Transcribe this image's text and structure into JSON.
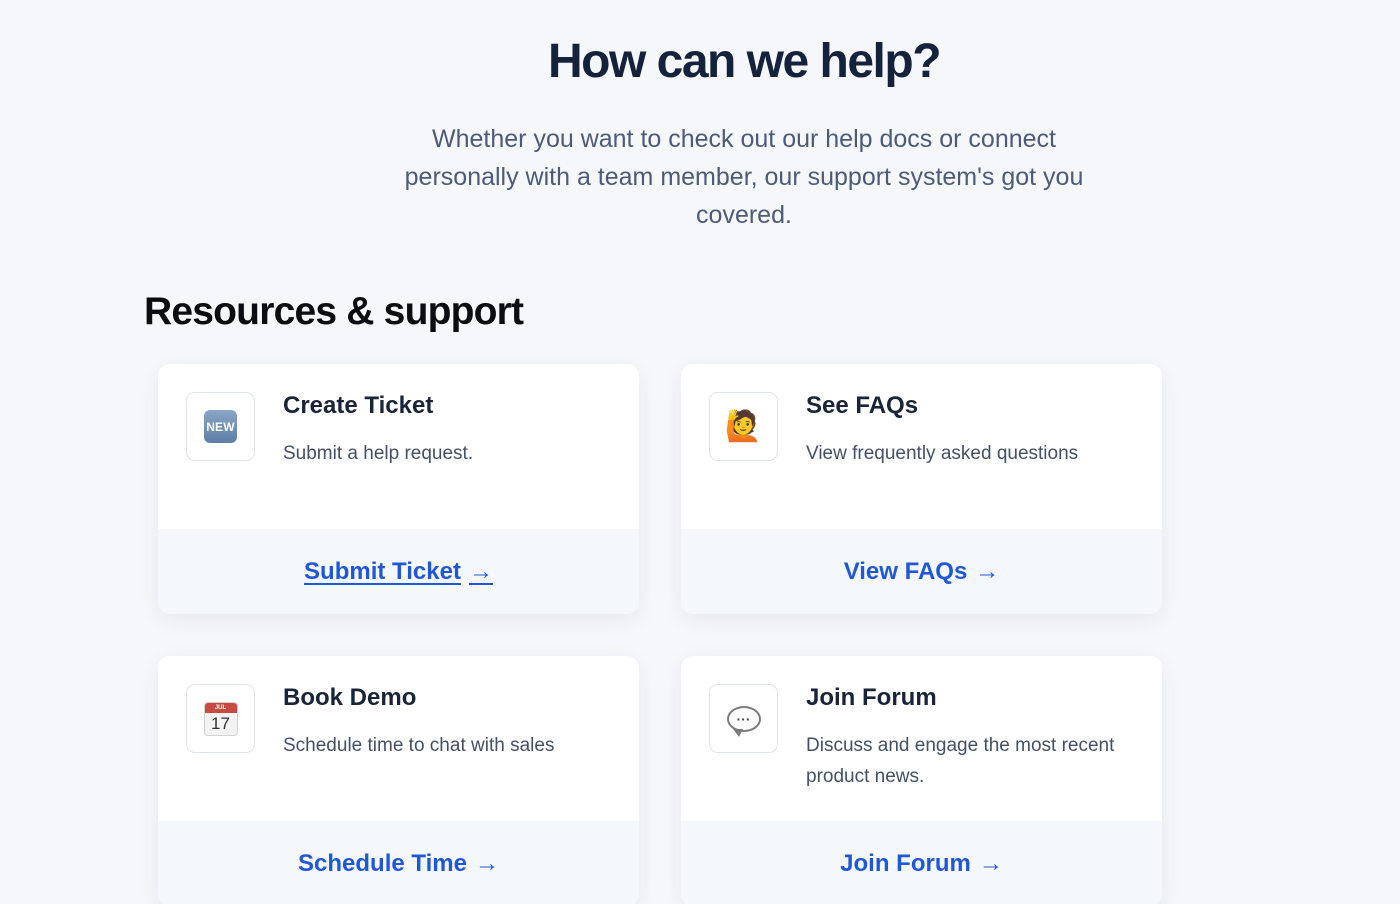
{
  "hero": {
    "title": "How can we help?",
    "subtitle": "Whether you want to check out our help docs or connect personally with a team member, our support system's got you covered."
  },
  "section": {
    "title": "Resources & support"
  },
  "cards": [
    {
      "icon": "new-badge-icon",
      "title": "Create Ticket",
      "description": "Submit a help request.",
      "link_label": "Submit Ticket",
      "arrow": "→"
    },
    {
      "icon": "person-raising-hand-icon",
      "title": "See FAQs",
      "description": "View frequently asked questions",
      "link_label": "View FAQs",
      "arrow": "→"
    },
    {
      "icon": "calendar-icon",
      "title": "Book Demo",
      "description": "Schedule time to chat with sales",
      "link_label": "Schedule Time",
      "arrow": "→"
    },
    {
      "icon": "speech-bubble-icon",
      "title": "Join Forum",
      "description": "Discuss and engage the most recent product news.",
      "link_label": "Join Forum",
      "arrow": "→"
    }
  ],
  "icon_text": {
    "new_badge": "NEW",
    "calendar_month": "JUL",
    "calendar_day": "17",
    "bubble_dots": "···",
    "person_glyph": "🙋"
  },
  "colors": {
    "background": "#f5f7fb",
    "heading": "#15223b",
    "link": "#2057d6",
    "card_footer": "#f4f7fc"
  }
}
